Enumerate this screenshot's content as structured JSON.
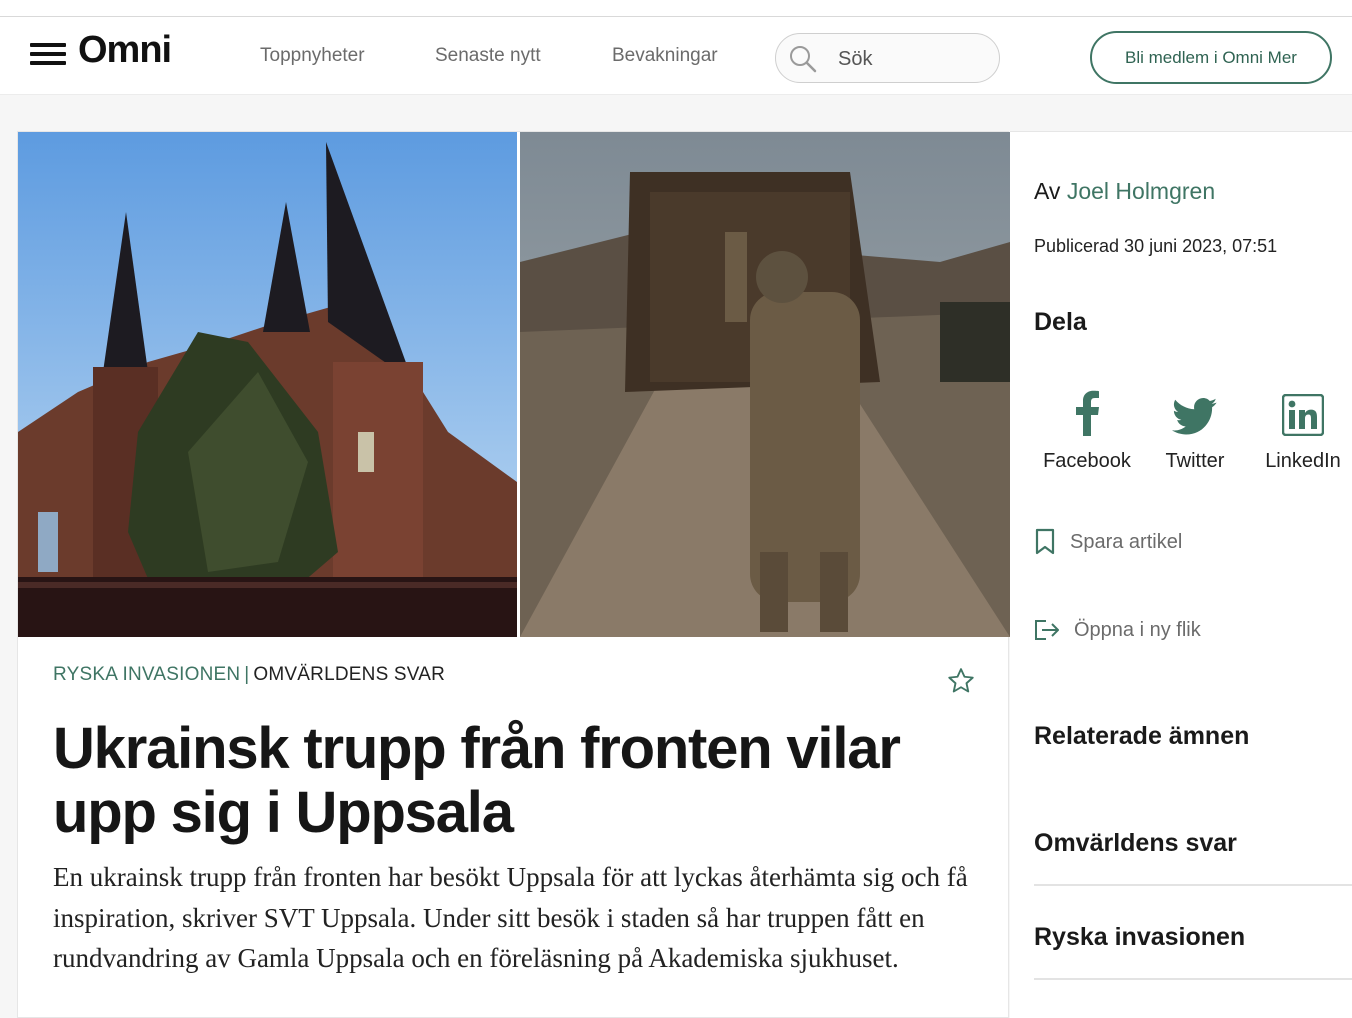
{
  "header": {
    "logo": "Omni",
    "nav": [
      "Toppnyheter",
      "Senaste nytt",
      "Bevakningar"
    ],
    "search_placeholder": "Sök",
    "join_label": "Bli medlem i Omni Mer"
  },
  "article": {
    "kicker_topic": "RYSKA INVASIONEN",
    "kicker_separator": "|",
    "kicker_subtopic": "OMVÄRLDENS SVAR",
    "title": "Ukrainsk trupp från fronten vilar upp sig i Uppsala",
    "lead": "En ukrainsk trupp från fronten har besökt Uppsala för att lyckas återhämta sig och få inspiration, skriver SVT Uppsala. Under sitt besök i staden så har truppen fått en rundvandring av Gamla Uppsala och en föreläsning på Akademiska sjukhuset."
  },
  "sidebar": {
    "byline_prefix": "Av",
    "author": "Joel Holmgren",
    "published": "Publicerad 30 juni 2023, 07:51",
    "share_heading": "Dela",
    "share": [
      {
        "label": "Facebook",
        "icon": "facebook-icon"
      },
      {
        "label": "Twitter",
        "icon": "twitter-icon"
      },
      {
        "label": "LinkedIn",
        "icon": "linkedin-icon"
      }
    ],
    "save_label": "Spara artikel",
    "open_label": "Öppna i ny flik",
    "related_heading": "Relaterade ämnen",
    "related": [
      "Omvärldens svar",
      "Ryska invasionen"
    ]
  },
  "colors": {
    "accent": "#3f7564",
    "icon_gray": "#3f7564"
  }
}
